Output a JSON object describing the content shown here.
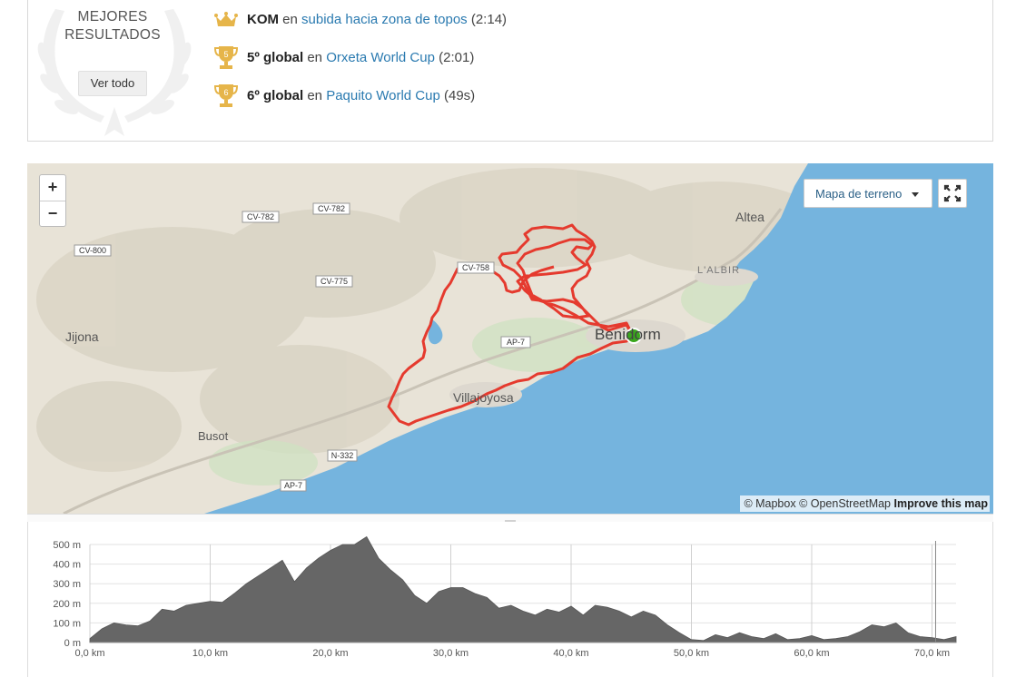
{
  "results": {
    "title_line1": "MEJORES",
    "title_line2": "RESULTADOS",
    "ver_todo": "Ver todo",
    "items": [
      {
        "badge": "crown",
        "rank": "KOM",
        "en": "en",
        "segment": "subida hacia zona de topos",
        "time": "(2:14)"
      },
      {
        "badge": "trophy-5",
        "badge_num": "5",
        "rank": "5º global",
        "en": "en",
        "segment": "Orxeta World Cup",
        "time": "(2:01)"
      },
      {
        "badge": "trophy-6",
        "badge_num": "6",
        "rank": "6º global",
        "en": "en",
        "segment": "Paquito World Cup",
        "time": "(49s)"
      }
    ]
  },
  "map": {
    "zoom_in": "+",
    "zoom_out": "−",
    "map_type": "Mapa de terreno",
    "attribution_mapbox": "© Mapbox",
    "attribution_osm": "© OpenStreetMap",
    "attribution_improve": "Improve this map",
    "places": {
      "altea": "Altea",
      "lalbir": "L'ALBIR",
      "benidorm": "Benidorm",
      "jijona": "Jijona",
      "villajoyosa": "Villajoyosa",
      "busot": "Busot"
    },
    "roads": {
      "cv782a": "CV-782",
      "cv782b": "CV-782",
      "cv800": "CV-800",
      "cv775": "CV-775",
      "cv758": "CV-758",
      "ap7a": "AP-7",
      "ap7b": "AP-7",
      "n332": "N-332"
    },
    "colors": {
      "route": "#e53a2e",
      "sea": "#75b4de",
      "land": "#e8e3d7",
      "start_marker": "#3aa71d"
    }
  },
  "chart_data": {
    "type": "area",
    "title": "",
    "xlabel": "",
    "ylabel": "",
    "x_ticks": [
      "0,0 km",
      "10,0 km",
      "20,0 km",
      "30,0 km",
      "40,0 km",
      "50,0 km",
      "60,0 km",
      "70,0 km"
    ],
    "y_ticks": [
      "0 m",
      "100 m",
      "200 m",
      "300 m",
      "400 m",
      "500 m"
    ],
    "xlim": [
      0,
      72
    ],
    "ylim": [
      0,
      500
    ],
    "color": "#666666",
    "x": [
      0,
      1,
      2,
      3,
      4,
      5,
      6,
      7,
      8,
      9,
      10,
      11,
      12,
      13,
      14,
      15,
      16,
      17,
      18,
      19,
      20,
      21,
      22,
      23,
      24,
      25,
      26,
      27,
      28,
      29,
      30,
      31,
      32,
      33,
      34,
      35,
      36,
      37,
      38,
      39,
      40,
      41,
      42,
      43,
      44,
      45,
      46,
      47,
      48,
      49,
      50,
      51,
      52,
      53,
      54,
      55,
      56,
      57,
      58,
      59,
      60,
      61,
      62,
      63,
      64,
      65,
      66,
      67,
      68,
      69,
      70,
      71,
      72
    ],
    "elevation": [
      20,
      70,
      100,
      90,
      85,
      110,
      170,
      160,
      190,
      200,
      210,
      205,
      250,
      300,
      340,
      380,
      420,
      310,
      380,
      430,
      470,
      500,
      500,
      540,
      430,
      370,
      320,
      240,
      200,
      260,
      280,
      280,
      250,
      230,
      175,
      190,
      160,
      140,
      170,
      155,
      185,
      140,
      190,
      180,
      160,
      130,
      160,
      140,
      90,
      50,
      15,
      10,
      40,
      25,
      50,
      30,
      20,
      45,
      15,
      20,
      35,
      15,
      20,
      30,
      55,
      90,
      80,
      100,
      50,
      30,
      25,
      15,
      30
    ]
  }
}
